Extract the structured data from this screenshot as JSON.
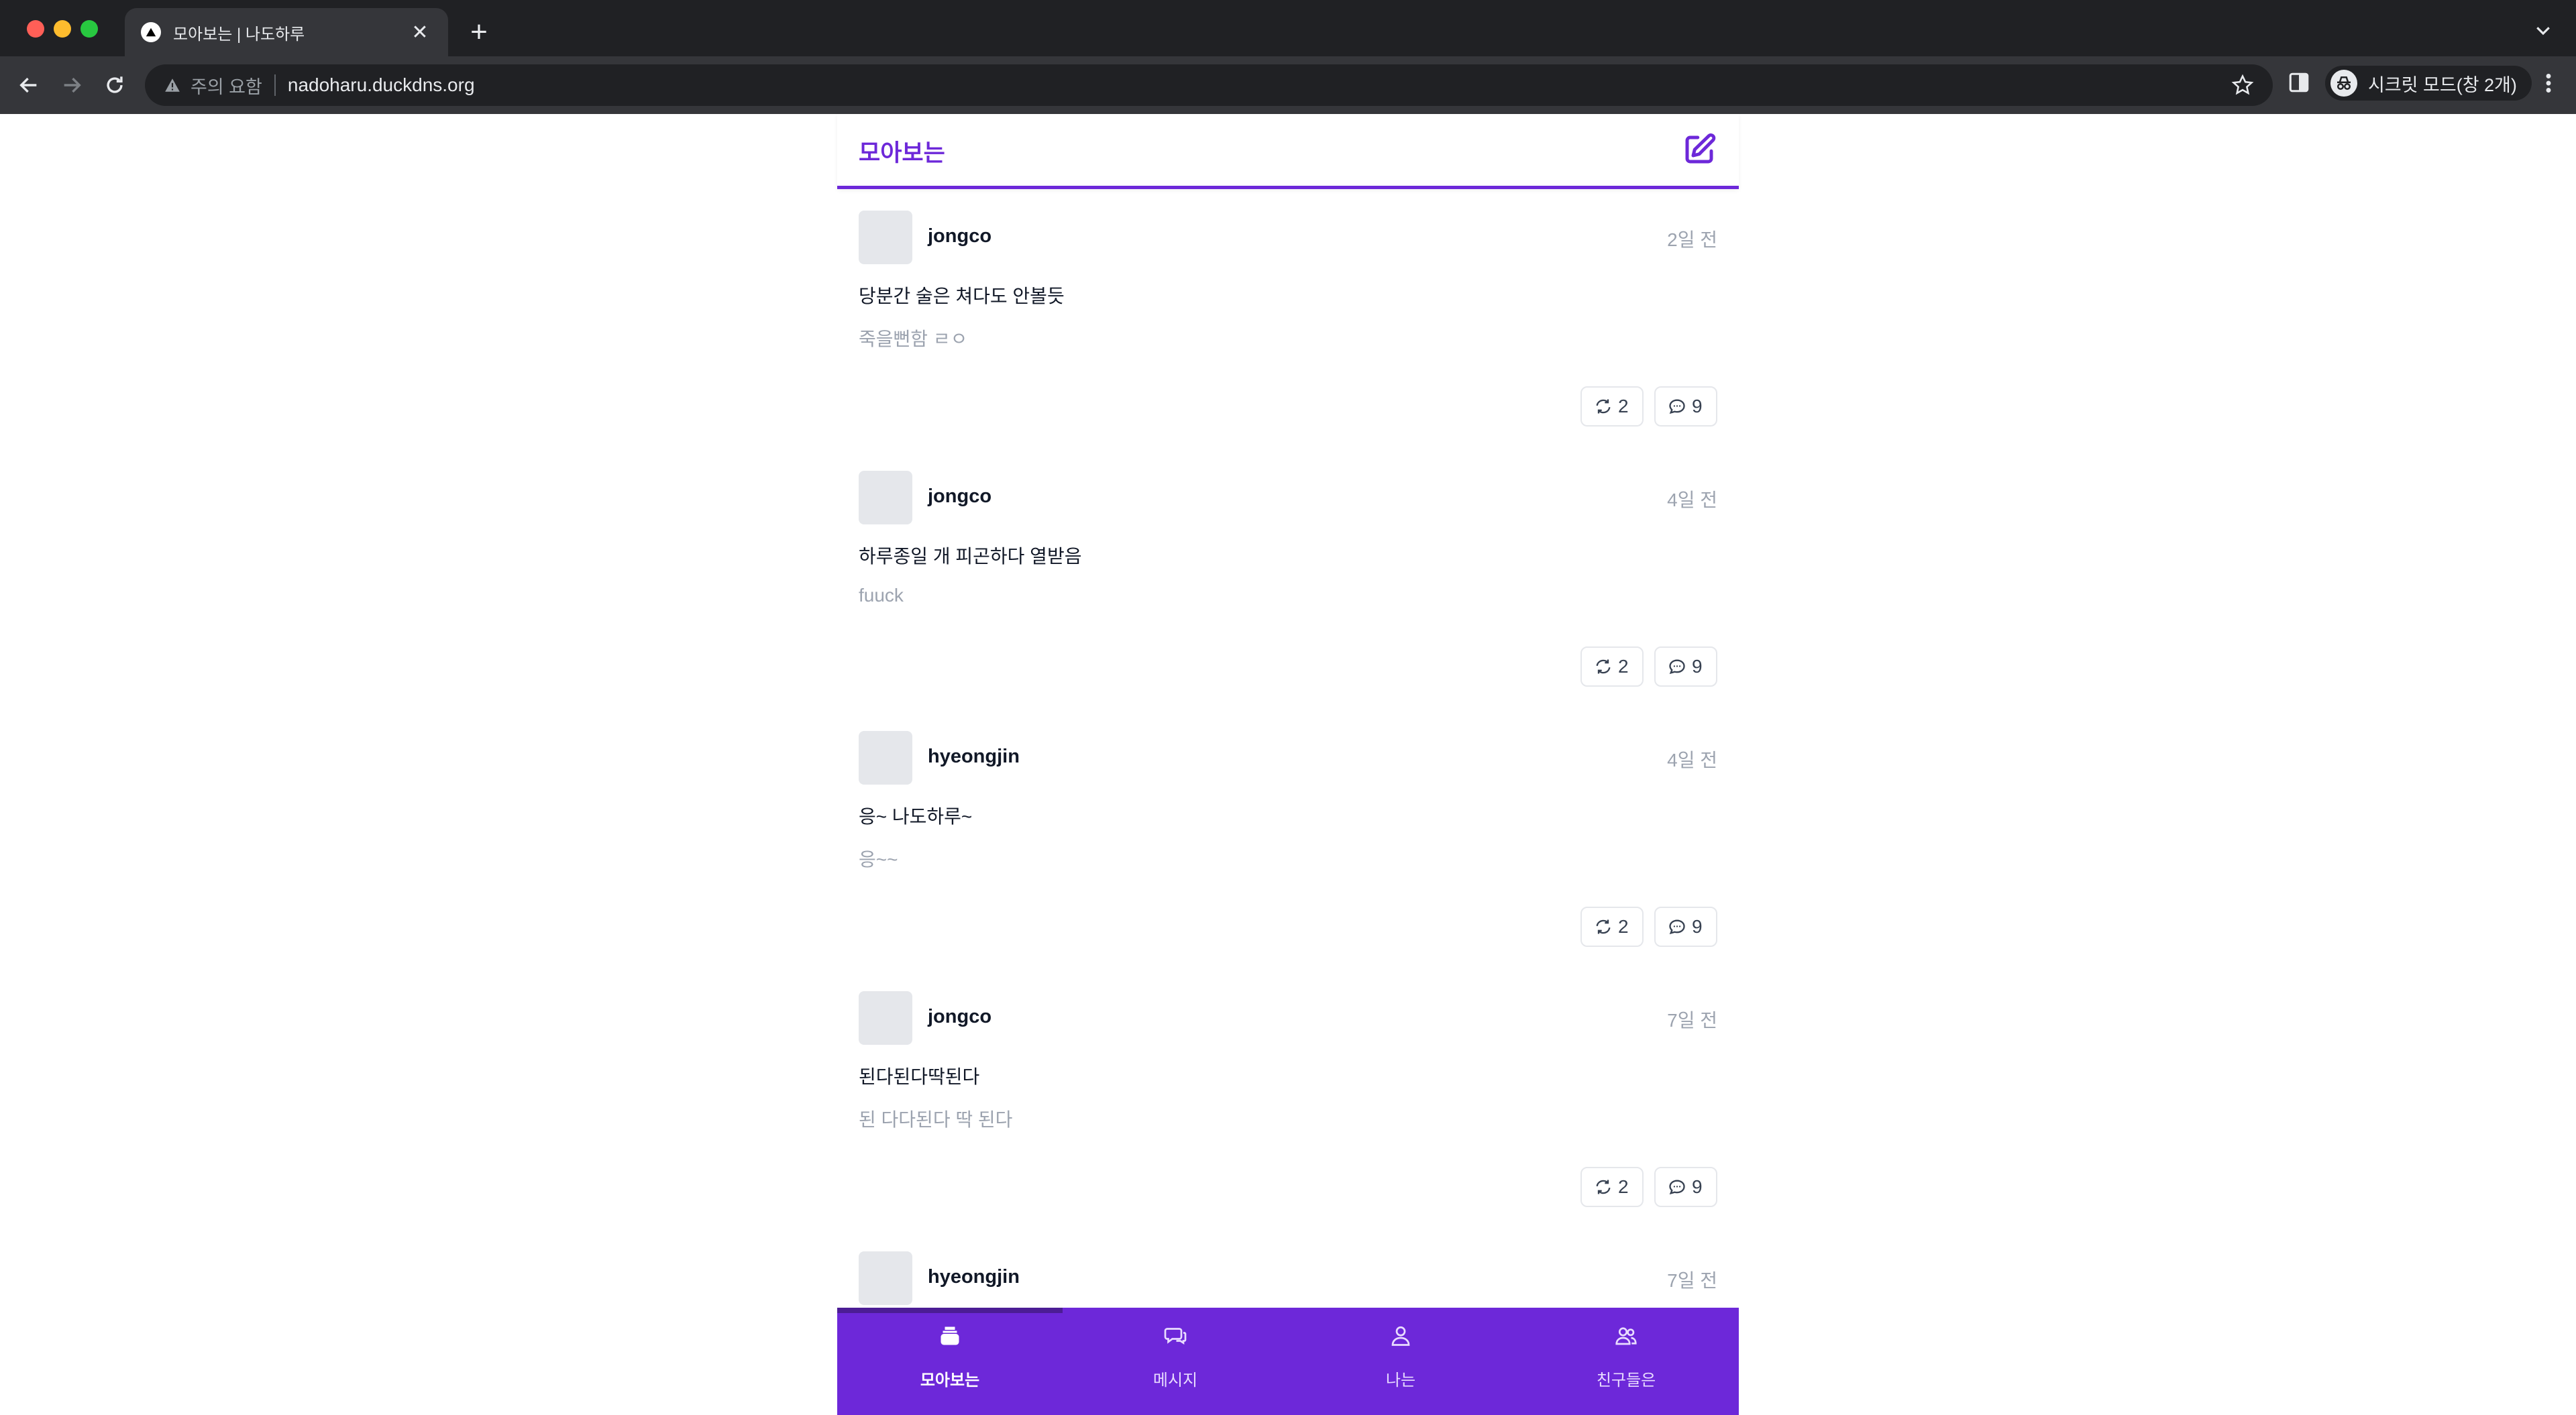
{
  "browser": {
    "tab_title": "모아보는 | 나도하루",
    "security_label": "주의 요함",
    "url": "nadoharu.duckdns.org",
    "profile_label": "시크릿 모드(창 2개)"
  },
  "app": {
    "header_title": "모아보는",
    "accent_color": "#6d28d9"
  },
  "posts": [
    {
      "username": "jongco",
      "time": "2일 전",
      "title": "당분간 술은 쳐다도 안볼듯",
      "body": "죽을뻔함 ㄹㅇ",
      "reposts": "2",
      "comments": "9"
    },
    {
      "username": "jongco",
      "time": "4일 전",
      "title": "하루종일 개 피곤하다 열받음",
      "body": "fuuck",
      "reposts": "2",
      "comments": "9"
    },
    {
      "username": "hyeongjin",
      "time": "4일 전",
      "title": "응~ 나도하루~",
      "body": "응~~",
      "reposts": "2",
      "comments": "9"
    },
    {
      "username": "jongco",
      "time": "7일 전",
      "title": "된다된다딱된다",
      "body": "된 다다된다 딱 된다",
      "reposts": "2",
      "comments": "9"
    },
    {
      "username": "hyeongjin",
      "time": "7일 전",
      "title": "",
      "body": "",
      "reposts": "",
      "comments": ""
    }
  ],
  "bottom_nav": [
    {
      "label": "모아보는",
      "icon": "inbox-stack-icon",
      "active": true
    },
    {
      "label": "메시지",
      "icon": "chat-bubbles-icon",
      "active": false
    },
    {
      "label": "나는",
      "icon": "user-icon",
      "active": false
    },
    {
      "label": "친구들은",
      "icon": "users-icon",
      "active": false
    }
  ]
}
